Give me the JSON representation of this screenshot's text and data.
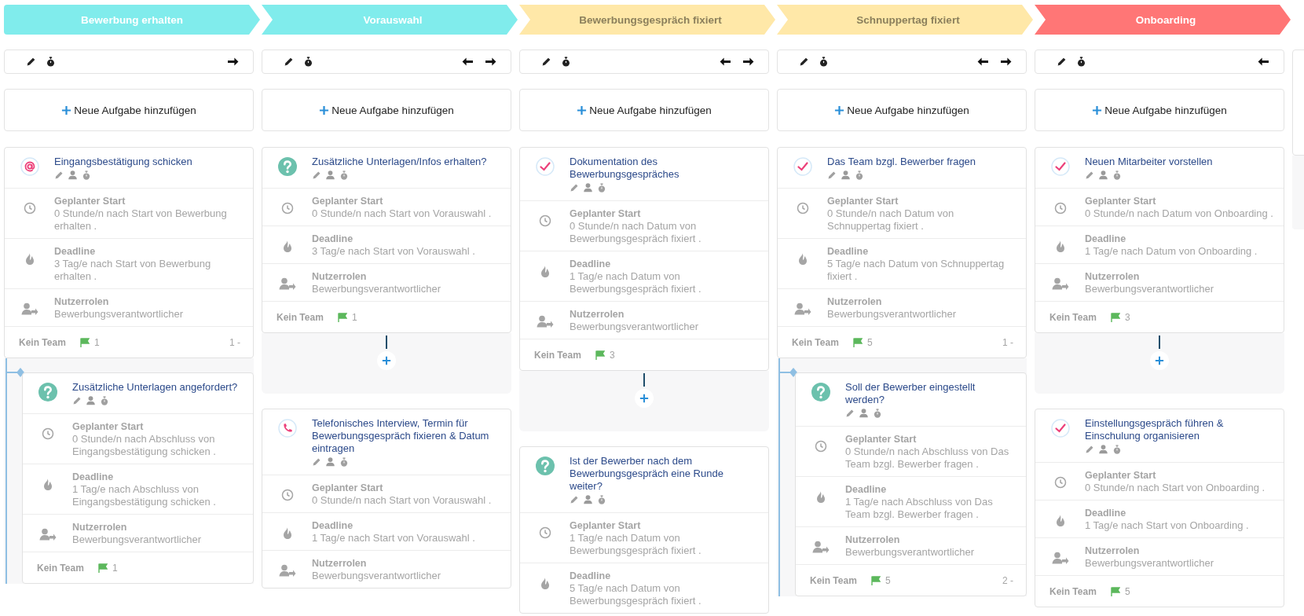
{
  "columns": [
    {
      "stage": {
        "title": "Bewerbung erhalten",
        "color": "#80ecec"
      },
      "toolbar": {
        "prev": false,
        "next": true
      },
      "add_label": "Neue Aufgabe hinzufügen",
      "items": [
        {
          "kind": "task",
          "task": {
            "kind": "at",
            "title": "Eingangsbestätigung schicken",
            "rows": [
              {
                "kind": "start",
                "label": "Geplanter Start",
                "value": "0 Stunde/n nach Start von Bewerbung erhalten ."
              },
              {
                "kind": "deadline",
                "label": "Deadline",
                "value": "3 Tag/e nach Start von Bewerbung erhalten ."
              },
              {
                "kind": "roles",
                "label": "Nutzerrolen",
                "value": "Bewerbungsverantwortlicher"
              }
            ],
            "footer": {
              "team": "Kein Team",
              "flags": "1",
              "order": "1 -"
            }
          }
        },
        {
          "kind": "subtask",
          "task": {
            "kind": "question",
            "title": "Zusätzliche Unterlagen angefordert?",
            "rows": [
              {
                "kind": "start",
                "label": "Geplanter Start",
                "value": "0 Stunde/n nach Abschluss von Eingangsbestätigung schicken ."
              },
              {
                "kind": "deadline",
                "label": "Deadline",
                "value": "1 Tag/e nach Abschluss von Eingangsbestätigung schicken ."
              },
              {
                "kind": "roles",
                "label": "Nutzerrolen",
                "value": "Bewerbungsverantwortlicher"
              }
            ],
            "footer": {
              "team": "Kein Team",
              "flags": "1"
            }
          }
        }
      ]
    },
    {
      "stage": {
        "title": "Vorauswahl",
        "color": "#80ecec"
      },
      "toolbar": {
        "prev": true,
        "next": true
      },
      "add_label": "Neue Aufgabe hinzufügen",
      "items": [
        {
          "kind": "task",
          "task": {
            "kind": "question",
            "title": "Zusätzliche Unterlagen/Infos erhalten?",
            "rows": [
              {
                "kind": "start",
                "label": "Geplanter Start",
                "value": "0 Stunde/n nach Start von Vorauswahl ."
              },
              {
                "kind": "deadline",
                "label": "Deadline",
                "value": "3 Tag/e nach Start von Vorauswahl ."
              },
              {
                "kind": "roles",
                "label": "Nutzerrolen",
                "value": "Bewerbungsverantwortlicher"
              }
            ],
            "footer": {
              "team": "Kein Team",
              "flags": "1"
            }
          }
        },
        {
          "kind": "add"
        },
        {
          "kind": "task",
          "task": {
            "kind": "phone",
            "title": "Telefonisches Interview, Termin für Bewerbungsgespräch fixieren & Datum eintragen",
            "rows": [
              {
                "kind": "start",
                "label": "Geplanter Start",
                "value": "0 Stunde/n nach Start von Vorauswahl ."
              },
              {
                "kind": "deadline",
                "label": "Deadline",
                "value": "1 Tag/e nach Start von Vorauswahl ."
              },
              {
                "kind": "roles",
                "label": "Nutzerrolen",
                "value": "Bewerbungsverantwortlicher"
              }
            ]
          }
        }
      ]
    },
    {
      "stage": {
        "title": "Bewerbungsgespräch fixiert",
        "color": "#ffe8a8"
      },
      "toolbar": {
        "prev": true,
        "next": true
      },
      "add_label": "Neue Aufgabe hinzufügen",
      "items": [
        {
          "kind": "task",
          "task": {
            "kind": "check",
            "title": "Dokumentation des Bewerbungsgespräches",
            "rows": [
              {
                "kind": "start",
                "label": "Geplanter Start",
                "value": "0 Stunde/n nach Datum von Bewerbungsgespräch fixiert ."
              },
              {
                "kind": "deadline",
                "label": "Deadline",
                "value": "1 Tag/e nach Datum von Bewerbungsgespräch fixiert ."
              },
              {
                "kind": "roles",
                "label": "Nutzerrolen",
                "value": "Bewerbungsverantwortlicher"
              }
            ],
            "footer": {
              "team": "Kein Team",
              "flags": "3"
            }
          }
        },
        {
          "kind": "add"
        },
        {
          "kind": "task",
          "task": {
            "kind": "question",
            "title": "Ist der Bewerber nach dem Bewerbungsgespräch eine Runde weiter?",
            "rows": [
              {
                "kind": "start",
                "label": "Geplanter Start",
                "value": "1 Tag/e nach Datum von Bewerbungsgespräch fixiert ."
              },
              {
                "kind": "deadline",
                "label": "Deadline",
                "value": "5 Tag/e nach Datum von Bewerbungsgespräch fixiert ."
              }
            ]
          }
        }
      ]
    },
    {
      "stage": {
        "title": "Schnuppertag fixiert",
        "color": "#ffe8a8"
      },
      "toolbar": {
        "prev": true,
        "next": true
      },
      "add_label": "Neue Aufgabe hinzufügen",
      "items": [
        {
          "kind": "task",
          "task": {
            "kind": "check",
            "title": "Das Team bzgl. Bewerber fragen",
            "rows": [
              {
                "kind": "start",
                "label": "Geplanter Start",
                "value": "0 Stunde/n nach Datum von Schnuppertag fixiert ."
              },
              {
                "kind": "deadline",
                "label": "Deadline",
                "value": "5 Tag/e nach Datum von Schnuppertag fixiert ."
              },
              {
                "kind": "roles",
                "label": "Nutzerrolen",
                "value": "Bewerbungsverantwortlicher"
              }
            ],
            "footer": {
              "team": "Kein Team",
              "flags": "5",
              "order": "1 -"
            }
          }
        },
        {
          "kind": "subtask",
          "task": {
            "kind": "question",
            "title": "Soll der Bewerber eingestellt werden?",
            "rows": [
              {
                "kind": "start",
                "label": "Geplanter Start",
                "value": "0 Stunde/n nach Abschluss von Das Team bzgl. Bewerber fragen ."
              },
              {
                "kind": "deadline",
                "label": "Deadline",
                "value": "1 Tag/e nach Abschluss von Das Team bzgl. Bewerber fragen ."
              },
              {
                "kind": "roles",
                "label": "Nutzerrolen",
                "value": "Bewerbungsverantwortlicher"
              }
            ],
            "footer": {
              "team": "Kein Team",
              "flags": "5",
              "order": "2 -"
            }
          }
        }
      ]
    },
    {
      "stage": {
        "title": "Onboarding",
        "color": "#ff7676"
      },
      "toolbar": {
        "prev": true,
        "next": false
      },
      "add_label": "Neue Aufgabe hinzufügen",
      "items": [
        {
          "kind": "task",
          "task": {
            "kind": "check",
            "title": "Neuen Mitarbeiter vorstellen",
            "rows": [
              {
                "kind": "start",
                "label": "Geplanter Start",
                "value": "0 Stunde/n nach Datum von Onboarding ."
              },
              {
                "kind": "deadline",
                "label": "Deadline",
                "value": "1 Tag/e nach Datum von Onboarding ."
              },
              {
                "kind": "roles",
                "label": "Nutzerrolen",
                "value": "Bewerbungsverantwortlicher"
              }
            ],
            "footer": {
              "team": "Kein Team",
              "flags": "3"
            }
          }
        },
        {
          "kind": "add"
        },
        {
          "kind": "task",
          "task": {
            "kind": "check",
            "title": "Einstellungsgespräch führen & Einschulung organisieren",
            "rows": [
              {
                "kind": "start",
                "label": "Geplanter Start",
                "value": "0 Stunde/n nach Start von Onboarding ."
              },
              {
                "kind": "deadline",
                "label": "Deadline",
                "value": "1 Tag/e nach Start von Onboarding ."
              },
              {
                "kind": "roles",
                "label": "Nutzerrolen",
                "value": "Bewerbungsverantwortlicher"
              }
            ],
            "footer": {
              "team": "Kein Team",
              "flags": "5"
            }
          }
        }
      ]
    }
  ]
}
